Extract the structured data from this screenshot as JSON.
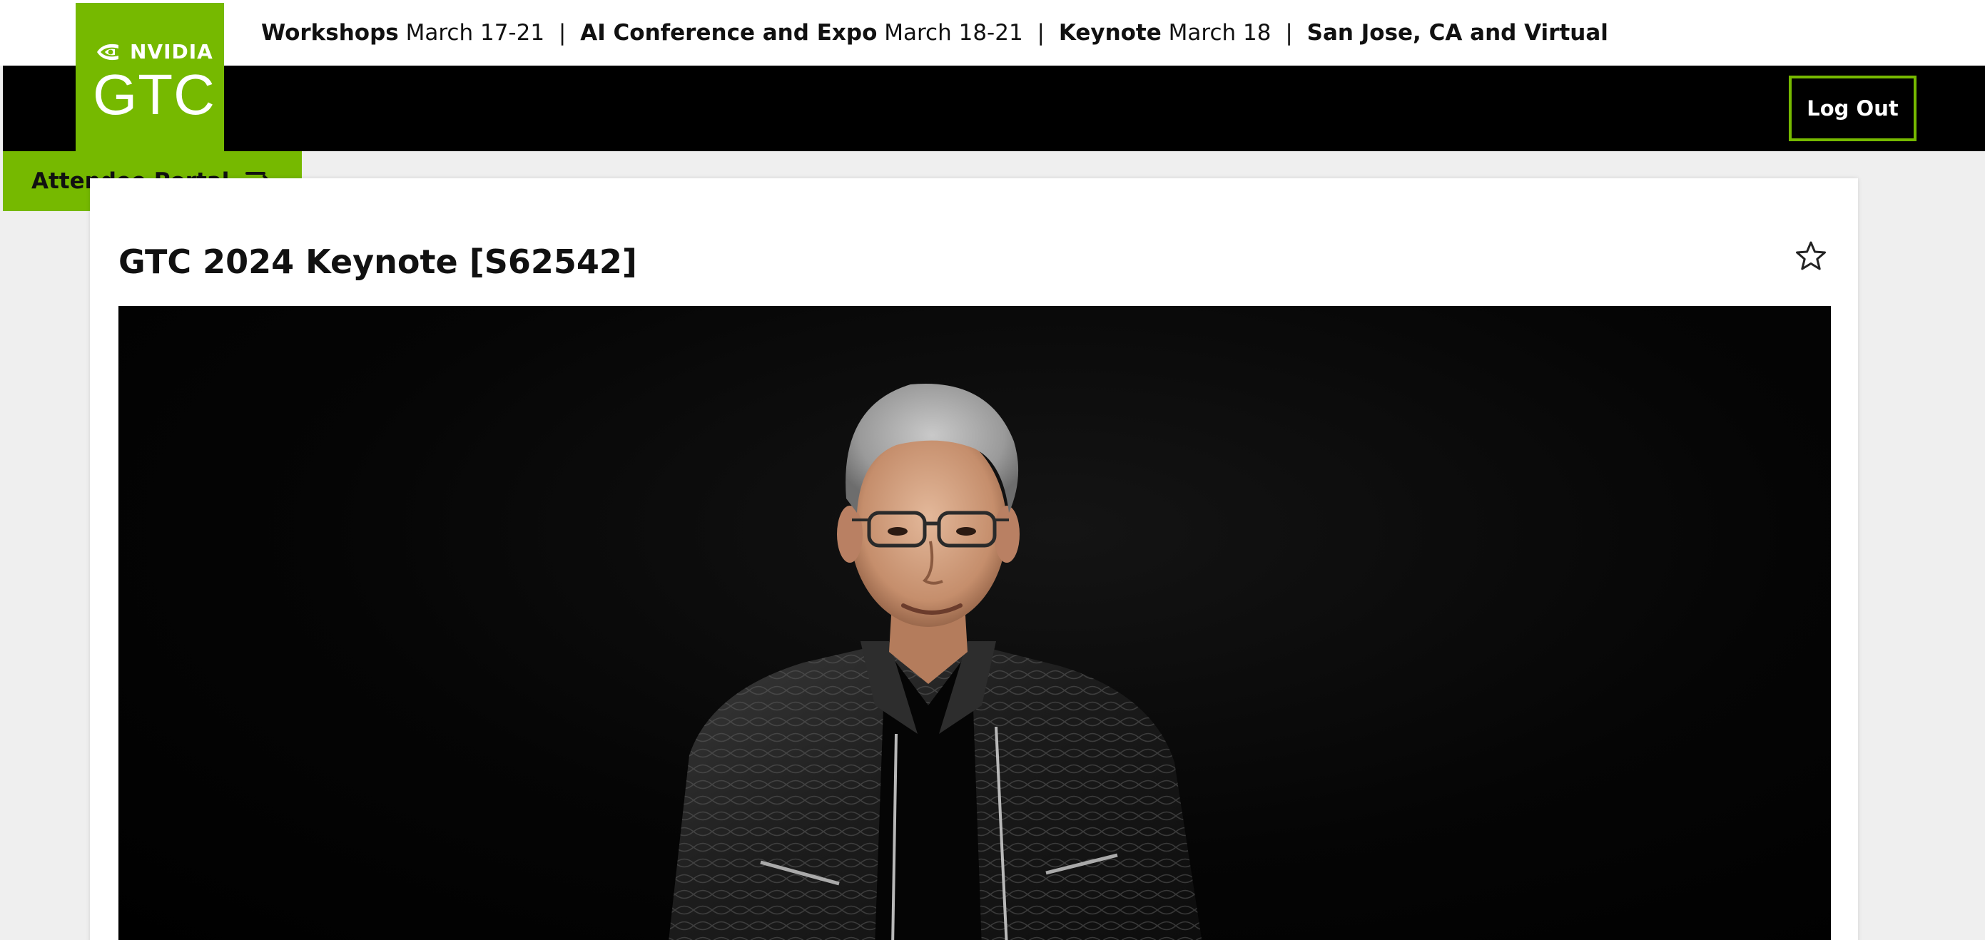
{
  "header": {
    "events": [
      {
        "name": "Workshops",
        "dates": "March 17-21"
      },
      {
        "name": "AI Conference and Expo",
        "dates": "March 18-21"
      },
      {
        "name": "Keynote",
        "dates": "March 18"
      }
    ],
    "separator": "|",
    "location": "San Jose, CA and Virtual"
  },
  "logo": {
    "brand": "NVIDIA",
    "event": "GTC"
  },
  "nav": {
    "portal_label": "Attendee Portal",
    "portal_icon": "menu-arrow-icon",
    "logout_label": "Log Out"
  },
  "session": {
    "title": "GTC 2024 Keynote [S62542]",
    "favorite_icon": "star-outline-icon"
  },
  "colors": {
    "brand_green": "#76b900",
    "nav_black": "#000000",
    "page_background": "#efefef"
  }
}
